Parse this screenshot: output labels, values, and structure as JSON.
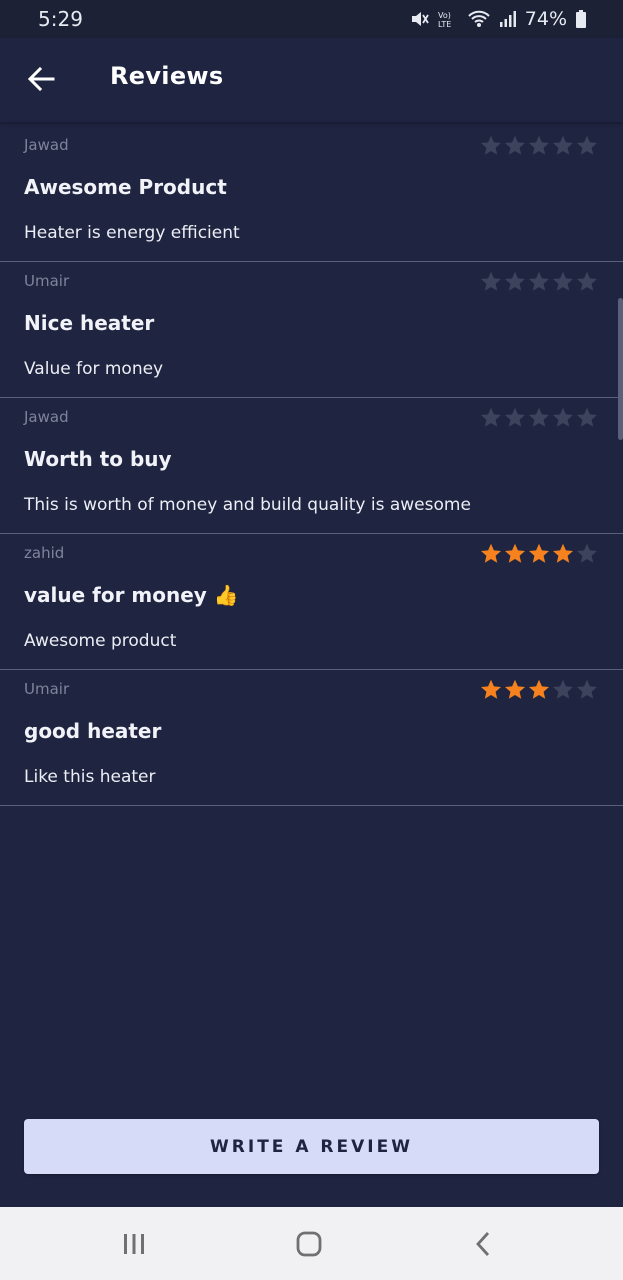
{
  "status_bar": {
    "time": "5:29",
    "battery": "74%",
    "icons": [
      "mute-icon",
      "volte-icon",
      "wifi-icon",
      "signal-icon",
      "battery-icon"
    ]
  },
  "app_bar": {
    "title": "Reviews",
    "back_icon": "arrow-left-icon"
  },
  "colors": {
    "background": "#1f2440",
    "star_filled": "#f5821f",
    "star_empty": "#3d435c",
    "button_bg": "#d6dcf7"
  },
  "reviews": [
    {
      "author": "Jawad",
      "title": "Awesome Product",
      "body": "Heater is energy efficient",
      "rating": 0
    },
    {
      "author": "Umair",
      "title": "Nice heater",
      "body": "Value for money",
      "rating": 0
    },
    {
      "author": "Jawad",
      "title": "Worth to buy",
      "body": "This is worth of money and build quality is awesome",
      "rating": 0
    },
    {
      "author": "zahid",
      "title": "value for money 👍",
      "body": "Awesome product",
      "rating": 4
    },
    {
      "author": "Umair",
      "title": "good heater",
      "body": "Like this heater",
      "rating": 3
    }
  ],
  "write_button_label": "WRITE A REVIEW",
  "nav": {
    "recents_icon": "recents-icon",
    "home_icon": "home-icon",
    "back_icon": "back-chevron-icon"
  }
}
